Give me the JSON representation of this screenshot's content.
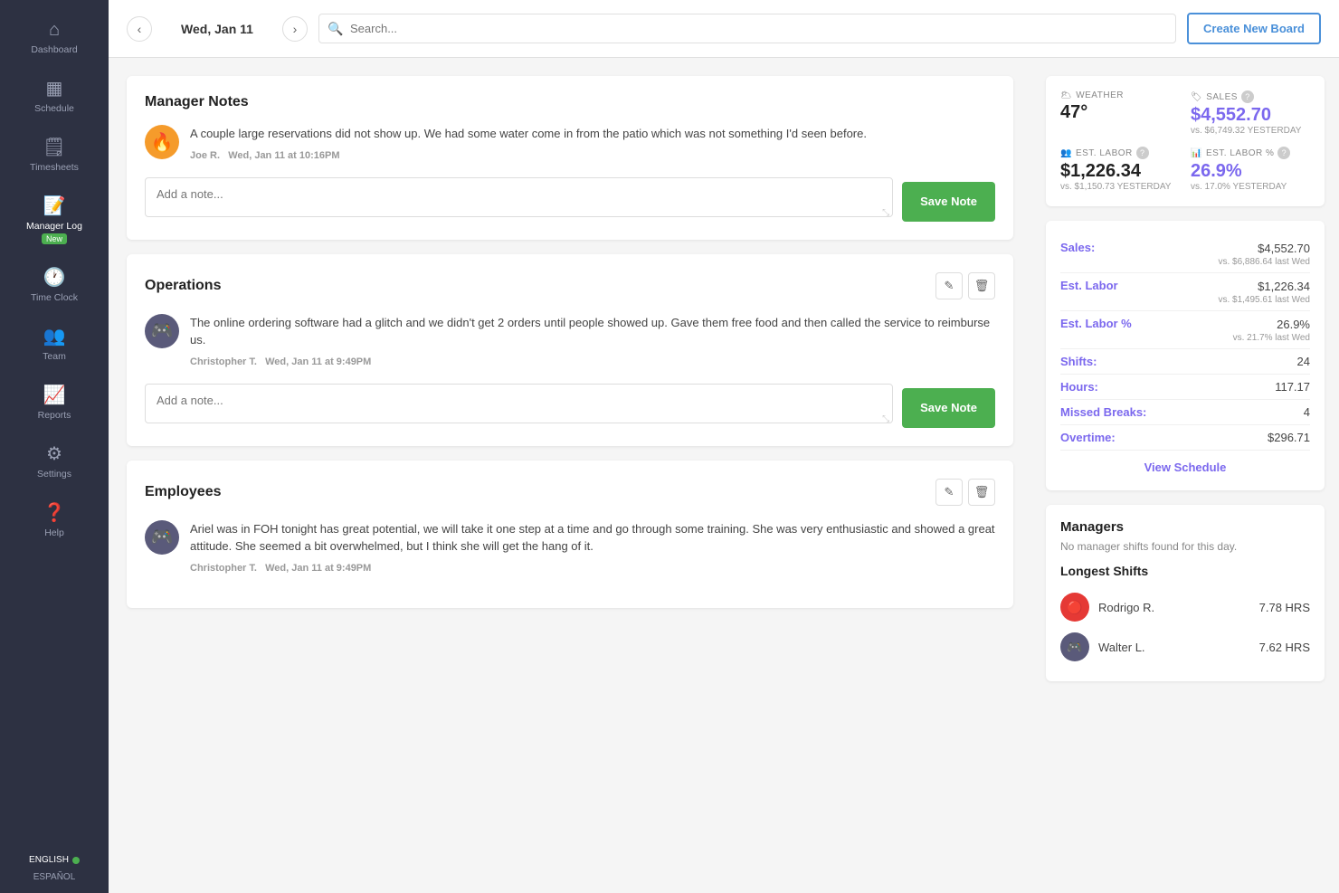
{
  "sidebar": {
    "items": [
      {
        "id": "dashboard",
        "label": "Dashboard",
        "icon": "⌂",
        "active": false
      },
      {
        "id": "schedule",
        "label": "Schedule",
        "icon": "📅",
        "active": false
      },
      {
        "id": "timesheets",
        "label": "Timesheets",
        "icon": "📋",
        "active": false
      },
      {
        "id": "manager-log",
        "label": "Manager Log",
        "icon": "📝",
        "active": true,
        "badge": "New"
      },
      {
        "id": "time-clock",
        "label": "Time Clock",
        "icon": "🕐",
        "active": false
      },
      {
        "id": "team",
        "label": "Team",
        "icon": "👥",
        "active": false
      },
      {
        "id": "reports",
        "label": "Reports",
        "icon": "📈",
        "active": false
      },
      {
        "id": "settings",
        "label": "Settings",
        "icon": "⚙",
        "active": false
      },
      {
        "id": "help",
        "label": "Help",
        "icon": "❓",
        "active": false
      }
    ],
    "lang_primary": "ENGLISH",
    "lang_secondary": "ESPAÑOL"
  },
  "topbar": {
    "date": "Wed, Jan 11",
    "search_placeholder": "Search...",
    "create_board_label": "Create New Board"
  },
  "manager_notes": {
    "title": "Manager Notes",
    "note": {
      "text": "A couple large reservations did not show up. We had some water come in from the patio which was not something I'd seen before.",
      "author": "Joe R.",
      "datetime": "Wed, Jan 11 at 10:16PM",
      "avatar_icon": "🔥",
      "avatar_bg": "fire"
    },
    "input_placeholder": "Add a note...",
    "save_label": "Save Note"
  },
  "operations": {
    "title": "Operations",
    "note": {
      "text": "The online ordering software had a glitch and we didn't get 2 orders until people showed up. Gave them free food and then called the service to reimburse us.",
      "author": "Christopher T.",
      "datetime": "Wed, Jan 11 at 9:49PM",
      "avatar_icon": "🎮",
      "avatar_bg": "game"
    },
    "input_placeholder": "Add a note...",
    "save_label": "Save Note"
  },
  "employees": {
    "title": "Employees",
    "note": {
      "text": "Ariel was in FOH tonight has great potential, we will take it one step at a time and go through some training. She was very enthusiastic and showed a great attitude. She seemed a bit overwhelmed, but I think she will get the hang of it.",
      "author": "Christopher T.",
      "datetime": "Wed, Jan 11 at 9:49PM",
      "avatar_icon": "🎮",
      "avatar_bg": "game"
    },
    "input_placeholder": "Add a note...",
    "save_label": "Save Note"
  },
  "weather": {
    "label": "WEATHER",
    "value": "47°",
    "icon": "🌥"
  },
  "sales_stat": {
    "label": "SALES",
    "value": "$4,552.70",
    "compare": "vs. $6,749.32 YESTERDAY"
  },
  "est_labor": {
    "label": "EST. LABOR",
    "value": "$1,226.34",
    "compare": "vs. $1,150.73 YESTERDAY"
  },
  "est_labor_pct": {
    "label": "EST. LABOR %",
    "value": "26.9%",
    "compare": "vs. 17.0% YESTERDAY"
  },
  "metrics": [
    {
      "name": "Sales:",
      "value": "$4,552.70",
      "compare": "vs. $6,886.64 last Wed"
    },
    {
      "name": "Est. Labor",
      "value": "$1,226.34",
      "compare": "vs. $1,495.61 last Wed"
    },
    {
      "name": "Est. Labor %",
      "value": "26.9%",
      "compare": "vs. 21.7% last Wed"
    },
    {
      "name": "Shifts:",
      "value": "24",
      "compare": ""
    },
    {
      "name": "Hours:",
      "value": "117.17",
      "compare": ""
    },
    {
      "name": "Missed Breaks:",
      "value": "4",
      "compare": ""
    },
    {
      "name": "Overtime:",
      "value": "$296.71",
      "compare": ""
    }
  ],
  "view_schedule_label": "View Schedule",
  "managers_section": {
    "title": "Managers",
    "no_shifts_text": "No manager shifts found for this day.",
    "longest_shifts_title": "Longest Shifts",
    "shifts": [
      {
        "name": "Rodrigo R.",
        "hours": "7.78 HRS",
        "avatar": "🔴",
        "avatar_bg": "rodrigo"
      },
      {
        "name": "Walter L.",
        "hours": "7.62 HRS",
        "avatar": "🎮",
        "avatar_bg": "game"
      }
    ]
  }
}
